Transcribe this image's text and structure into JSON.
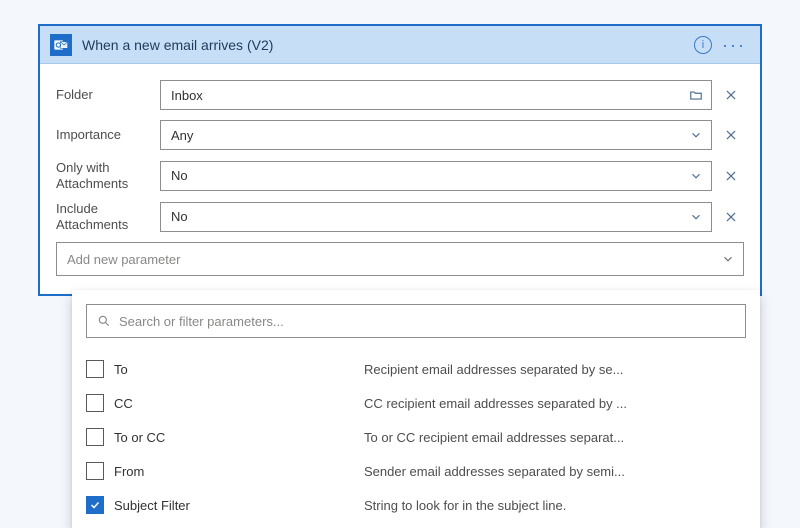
{
  "header": {
    "title": "When a new email arrives (V2)"
  },
  "fields": {
    "folder": {
      "label": "Folder",
      "value": "Inbox"
    },
    "importance": {
      "label": "Importance",
      "value": "Any"
    },
    "onlyAttachments": {
      "label": "Only with Attachments",
      "value": "No"
    },
    "includeAttachments": {
      "label": "Include Attachments",
      "value": "No"
    }
  },
  "addParam": {
    "placeholder": "Add new parameter"
  },
  "search": {
    "placeholder": "Search or filter parameters..."
  },
  "params": [
    {
      "name": "To",
      "desc": "Recipient email addresses separated by se...",
      "checked": false
    },
    {
      "name": "CC",
      "desc": "CC recipient email addresses separated by ...",
      "checked": false
    },
    {
      "name": "To or CC",
      "desc": "To or CC recipient email addresses separat...",
      "checked": false
    },
    {
      "name": "From",
      "desc": "Sender email addresses separated by semi...",
      "checked": false
    },
    {
      "name": "Subject Filter",
      "desc": "String to look for in the subject line.",
      "checked": true
    }
  ]
}
